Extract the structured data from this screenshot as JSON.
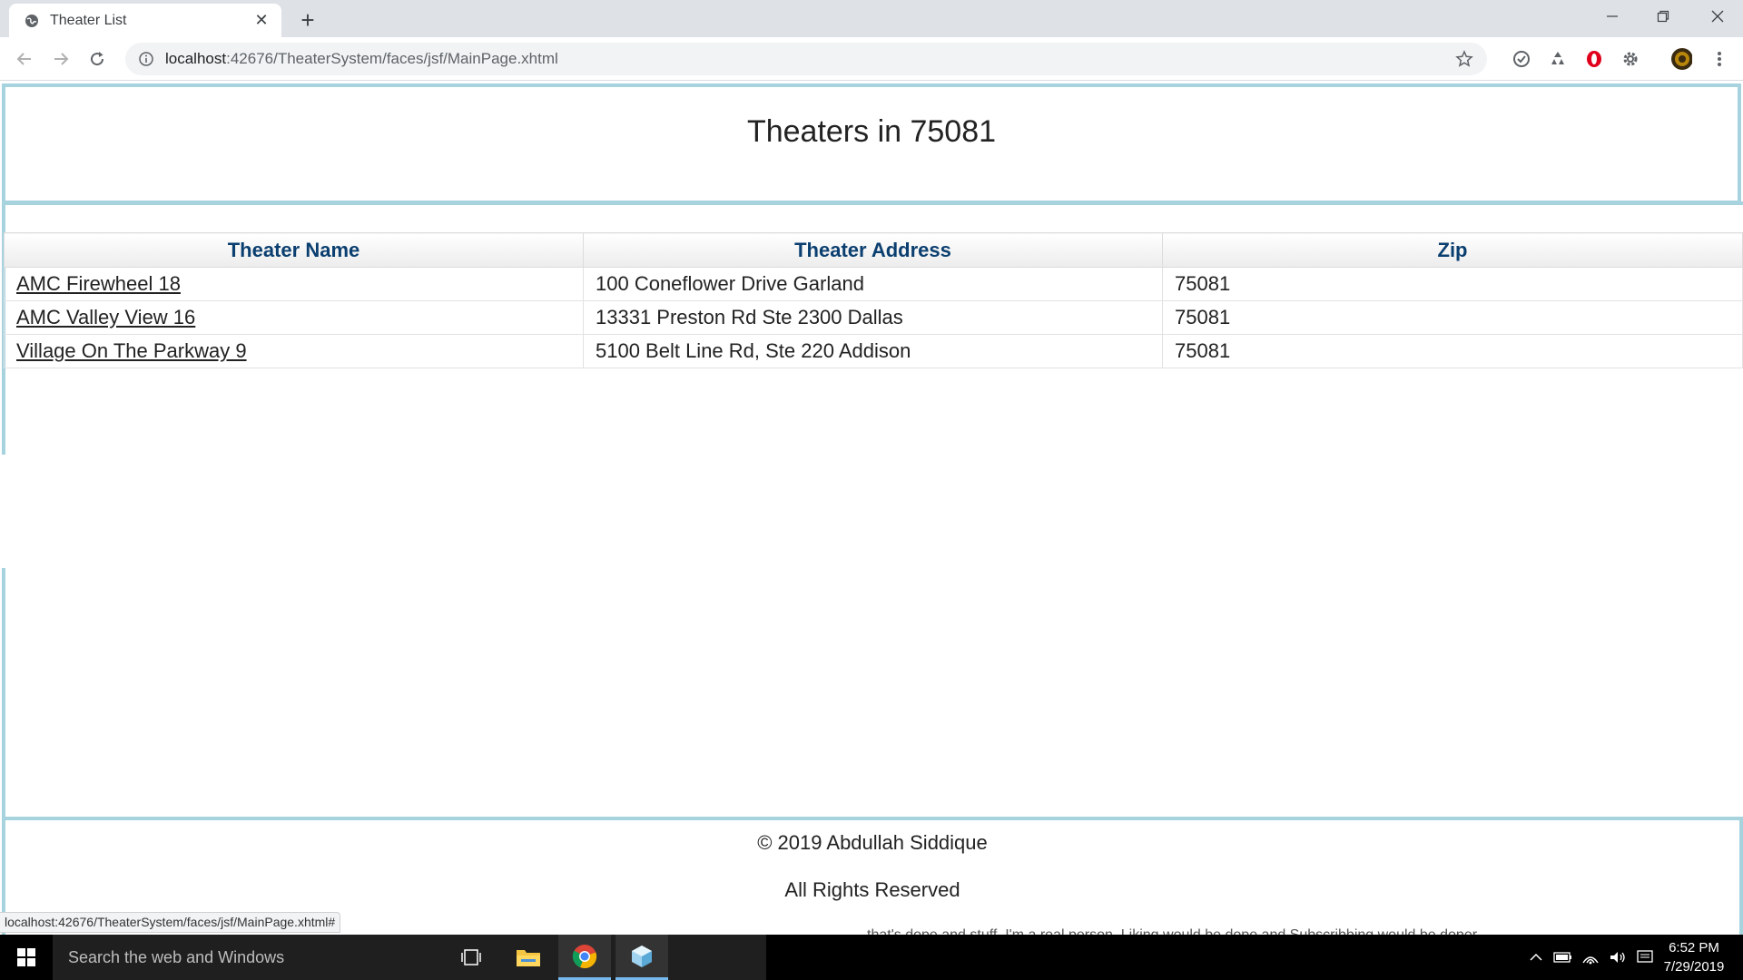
{
  "browser": {
    "tab_title": "Theater List",
    "url_host": "localhost",
    "url_path": ":42676/TheaterSystem/faces/jsf/MainPage.xhtml",
    "status_url": "localhost:42676/TheaterSystem/faces/jsf/MainPage.xhtml#"
  },
  "page": {
    "heading": "Theaters in 75081",
    "table": {
      "columns": [
        "Theater Name",
        "Theater Address",
        "Zip"
      ],
      "rows": [
        {
          "name": "AMC Firewheel 18",
          "address": "100 Coneflower Drive Garland",
          "zip": "75081"
        },
        {
          "name": "AMC Valley View 16",
          "address": "13331 Preston Rd Ste 2300 Dallas",
          "zip": "75081"
        },
        {
          "name": "Village On The Parkway 9",
          "address": "5100 Belt Line Rd, Ste 220 Addison",
          "zip": "75081"
        }
      ]
    },
    "footer": {
      "copyright": "© 2019 Abdullah Siddique",
      "rights": "All Rights Reserved"
    },
    "background_text": "that's dope and stuff. I'm a real person. Liking would be dope and Subscribbing would be doper."
  },
  "taskbar": {
    "search_placeholder": "Search the web and Windows",
    "time": "6:52 PM",
    "date": "7/29/2019"
  },
  "colors": {
    "frame_border": "#a7d3df",
    "header_text": "#0b3f70"
  }
}
